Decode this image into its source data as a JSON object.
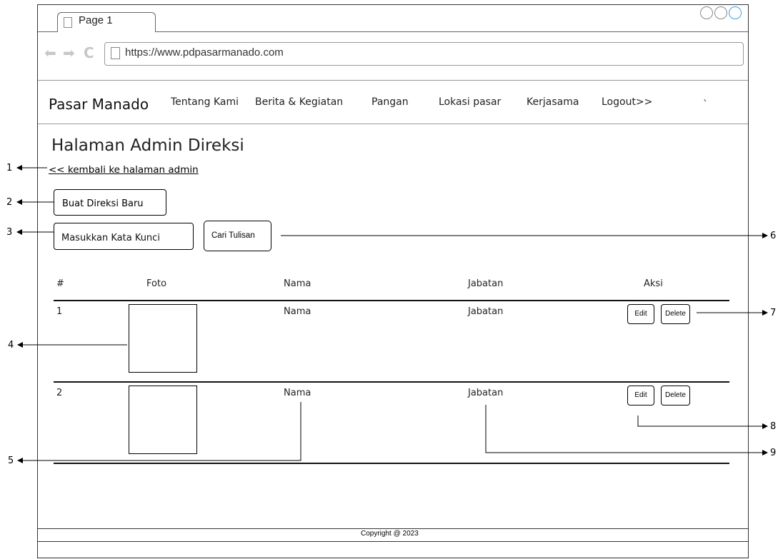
{
  "browser": {
    "tab_label": "Page 1",
    "url": "https://www.pdpasarmanado.com",
    "back_icon": "back-arrow-icon",
    "forward_icon": "forward-arrow-icon",
    "reload_icon": "reload-icon"
  },
  "navbar": {
    "brand": "Pasar Manado",
    "items": [
      "Tentang Kami",
      "Berita & Kegiatan",
      "Pangan",
      "Lokasi pasar",
      "Kerjasama",
      "Logout>>"
    ],
    "stray_mark": "`"
  },
  "page": {
    "title": "Halaman Admin Direksi",
    "back_link": "<< kembali ke halaman admin ",
    "create_button": "Buat Direksi Baru",
    "search_placeholder": "Masukkan Kata Kunci",
    "search_button": "Cari Tulisan"
  },
  "table": {
    "headers": [
      "#",
      "Foto",
      "Nama",
      "Jabatan",
      "Aksi"
    ],
    "rows": [
      {
        "no": "1",
        "nama": "Nama",
        "jabatan": "Jabatan",
        "edit": "Edit",
        "delete": "Delete"
      },
      {
        "no": "2",
        "nama": "Nama",
        "jabatan": "Jabatan",
        "edit": "Edit",
        "delete": "Delete"
      }
    ]
  },
  "footer": {
    "text": "Copyright @ 2023"
  },
  "annotations": [
    "1",
    "2",
    "3",
    "4",
    "5",
    "6",
    "7",
    "8",
    "9"
  ]
}
